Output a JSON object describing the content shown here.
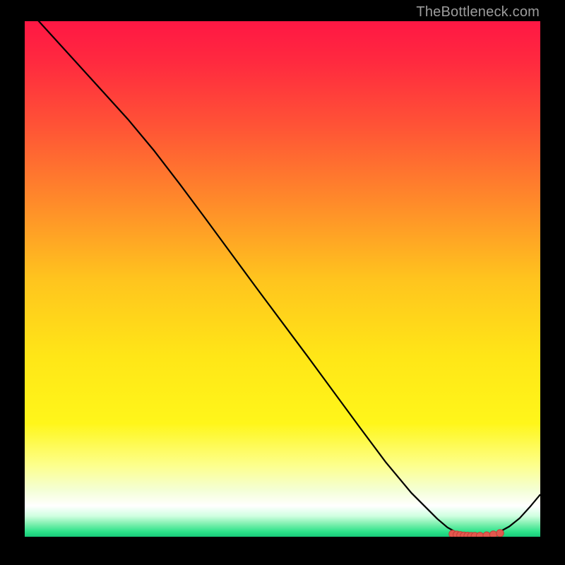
{
  "credit": "TheBottleneck.com",
  "colors": {
    "black": "#000000",
    "gradient_stops": [
      {
        "offset": 0.0,
        "color": "#ff1744"
      },
      {
        "offset": 0.08,
        "color": "#ff2a3f"
      },
      {
        "offset": 0.2,
        "color": "#ff5236"
      },
      {
        "offset": 0.35,
        "color": "#ff8a2a"
      },
      {
        "offset": 0.5,
        "color": "#ffc41e"
      },
      {
        "offset": 0.65,
        "color": "#ffe617"
      },
      {
        "offset": 0.78,
        "color": "#fff61a"
      },
      {
        "offset": 0.86,
        "color": "#fdff8a"
      },
      {
        "offset": 0.91,
        "color": "#f4ffd6"
      },
      {
        "offset": 0.94,
        "color": "#ffffff"
      },
      {
        "offset": 0.96,
        "color": "#cfffe0"
      },
      {
        "offset": 0.975,
        "color": "#7ff0b0"
      },
      {
        "offset": 0.99,
        "color": "#2de38a"
      },
      {
        "offset": 1.0,
        "color": "#17c97a"
      }
    ],
    "line": "#000000",
    "marker_fill": "#e2584e",
    "marker_stroke": "#c24038"
  },
  "chart_data": {
    "type": "line",
    "title": "",
    "xlabel": "",
    "ylabel": "",
    "xlim": [
      0,
      100
    ],
    "ylim": [
      0,
      100
    ],
    "grid": false,
    "legend": false,
    "series": [
      {
        "name": "curve",
        "x": [
          0,
          5,
          10,
          15,
          20,
          25,
          30,
          35,
          40,
          45,
          50,
          55,
          60,
          65,
          70,
          75,
          80,
          82,
          84,
          86,
          88,
          90,
          92,
          94,
          96,
          98,
          100
        ],
        "y": [
          103,
          97.5,
          92,
          86.5,
          81,
          75,
          68.5,
          61.8,
          55,
          48.2,
          41.5,
          34.8,
          28,
          21.2,
          14.5,
          8.5,
          3.5,
          1.8,
          0.7,
          0.25,
          0.15,
          0.3,
          0.9,
          2.0,
          3.6,
          5.8,
          8.2
        ]
      }
    ],
    "markers": {
      "name": "bottom-cluster",
      "x": [
        83.0,
        83.8,
        84.5,
        85.2,
        85.9,
        86.6,
        87.3,
        88.3,
        89.6,
        90.9,
        92.2
      ],
      "y": [
        0.55,
        0.4,
        0.3,
        0.22,
        0.18,
        0.15,
        0.14,
        0.16,
        0.24,
        0.42,
        0.7
      ]
    }
  }
}
